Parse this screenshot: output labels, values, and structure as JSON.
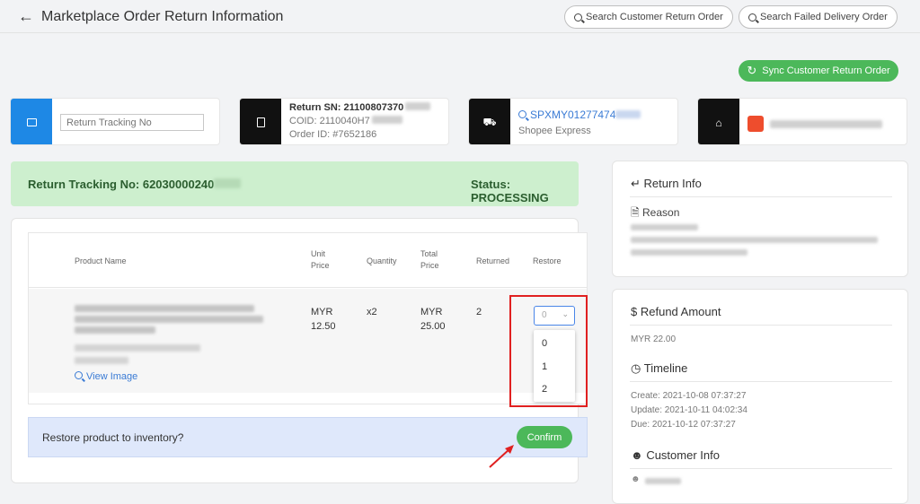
{
  "header": {
    "back_icon": "arrow-left-icon",
    "title": "Marketplace Order Return Information",
    "search_customer_return": "Search Customer Return Order",
    "search_failed_delivery": "Search Failed Delivery Order"
  },
  "sync_button": "Sync Customer Return Order",
  "cards": {
    "tracking_placeholder": "Return Tracking No",
    "return_sn": "Return SN: 21100807370",
    "coid": "COID: 2110040H7",
    "order_id": "Order ID: #7652186",
    "shipment_no": "SPXMY01277474",
    "courier": "Shopee Express"
  },
  "status_bar": {
    "tracking": "Return Tracking No: 62030000240",
    "status": "Status: PROCESSING"
  },
  "table": {
    "headers": {
      "product_name": "Product Name",
      "unit_price": "Unit Price",
      "quantity": "Quantity",
      "total_price": "Total Price",
      "returned": "Returned",
      "restore": "Restore"
    },
    "row": {
      "unit_price": "MYR 12.50",
      "quantity": "x2",
      "total_price": "MYR 25.00",
      "returned": "2",
      "view_image": "View Image",
      "restore_selected": "0",
      "restore_options": [
        "0",
        "1",
        "2"
      ]
    }
  },
  "restore_bar": {
    "question": "Restore product to inventory?",
    "confirm": "Confirm"
  },
  "return_info": {
    "title": "Return Info",
    "reason_label": "Reason"
  },
  "refund": {
    "title": "Refund Amount",
    "amount": "MYR 22.00"
  },
  "timeline": {
    "title": "Timeline",
    "create": "Create: 2021-10-08 07:37:27",
    "update": "Update: 2021-10-11 04:02:34",
    "due": "Due: 2021-10-12 07:37:27"
  },
  "customer": {
    "title": "Customer Info"
  },
  "colors": {
    "accent_green": "#4cb85a",
    "link_blue": "#3a7bd5",
    "highlight_red": "#e02020",
    "status_bg": "#cdefce"
  }
}
